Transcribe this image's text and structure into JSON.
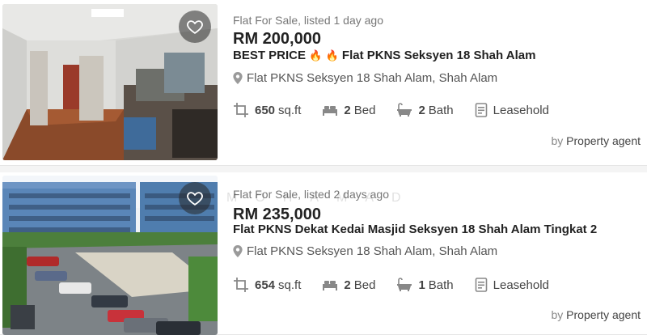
{
  "listings": [
    {
      "subtitle": "Flat For Sale, listed 1 day ago",
      "price": "RM 200,000",
      "title_prefix": "BEST PRICE",
      "title_rest": "Flat PKNS Seksyen 18 Shah Alam",
      "address": "Flat PKNS Seksyen 18 Shah Alam, Shah Alam",
      "area_value": "650",
      "area_unit": "sq.ft",
      "bed_value": "2",
      "bed_label": "Bed",
      "bath_value": "2",
      "bath_label": "Bath",
      "tenure": "Leasehold",
      "agent_by": "by",
      "agent": "Property agent"
    },
    {
      "subtitle": "Flat For Sale, listed 2 days ago",
      "price": "RM 235,000",
      "title": "Flat PKNS Dekat Kedai Masjid Seksyen 18 Shah Alam Tingkat 2",
      "address": "Flat PKNS Seksyen 18 Shah Alam, Shah Alam",
      "area_value": "654",
      "area_unit": "sq.ft",
      "bed_value": "2",
      "bed_label": "Bed",
      "bath_value": "1",
      "bath_label": "Bath",
      "tenure": "Leasehold",
      "agent_by": "by",
      "agent": "Property agent"
    }
  ],
  "watermark": "MOHAMAD",
  "icons": {
    "favorite": "heart-outline-icon",
    "location": "map-pin-icon",
    "area": "area-crop-icon",
    "bed": "bed-icon",
    "bath": "bathtub-icon",
    "tenure": "document-icon",
    "fire": "🔥"
  },
  "colors": {
    "text_dark": "#222222",
    "text_muted": "#777777",
    "icon_gray": "#888888"
  }
}
